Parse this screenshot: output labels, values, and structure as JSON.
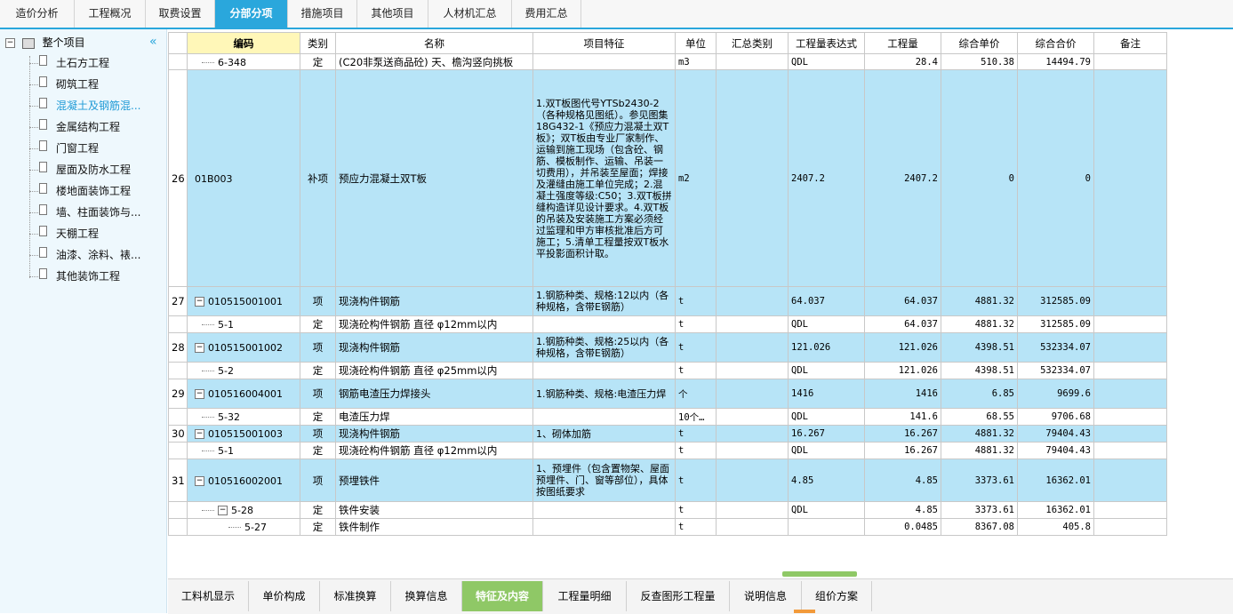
{
  "top_tabs": [
    "造价分析",
    "工程概况",
    "取费设置",
    "分部分项",
    "措施项目",
    "其他项目",
    "人材机汇总",
    "费用汇总"
  ],
  "active_top_tab": "分部分项",
  "tree": {
    "root": "整个项目",
    "items": [
      "土石方工程",
      "砌筑工程",
      "混凝土及钢筋混...",
      "金属结构工程",
      "门窗工程",
      "屋面及防水工程",
      "楼地面装饰工程",
      "墙、柱面装饰与...",
      "天棚工程",
      "油漆、涂料、裱...",
      "其他装饰工程"
    ],
    "selected": "混凝土及钢筋混..."
  },
  "columns": [
    "编码",
    "类别",
    "名称",
    "项目特征",
    "单位",
    "汇总类别",
    "工程量表达式",
    "工程量",
    "综合单价",
    "综合合价",
    "备注"
  ],
  "rows": [
    {
      "idx": "",
      "code": "6-348",
      "type": "定",
      "name": "(C20非泵送商品砼) 天、檐沟竖向挑板",
      "feature": "",
      "unit": "m3",
      "expr": "QDL",
      "qty": "28.4",
      "price": "510.38",
      "total": "14494.79",
      "blue": false,
      "level": 2,
      "box": false
    },
    {
      "idx": "26",
      "code": "01B003",
      "type": "补项",
      "name": "预应力混凝土双T板",
      "feature": "1.双T板图代号YTSb2430-2（各种规格见图纸）。参见图集18G432-1《预应力混凝土双T板》；双T板由专业厂家制作、运输到施工现场（包含砼、钢筋、模板制作、运输、吊装一切费用），并吊装至屋面；焊接及灌缝由施工单位完成；2.混凝土强度等级:C50；3.双T板拼缝构造详见设计要求。4.双T板的吊装及安装施工方案必须经过监理和甲方审核批准后方可施工；5.清单工程量按双T板水平投影面积计取。",
      "unit": "m2",
      "expr": "2407.2",
      "qty": "2407.2",
      "price": "0",
      "total": "0",
      "blue": true,
      "level": 1,
      "box": false
    },
    {
      "idx": "27",
      "code": "010515001001",
      "type": "项",
      "name": "现浇构件钢筋",
      "feature": "1.钢筋种类、规格:12以内（各种规格，含带E钢筋）",
      "unit": "t",
      "expr": "64.037",
      "qty": "64.037",
      "price": "4881.32",
      "total": "312585.09",
      "blue": true,
      "level": 1,
      "box": true
    },
    {
      "idx": "",
      "code": "5-1",
      "type": "定",
      "name": "现浇砼构件钢筋 直径 φ12mm以内",
      "feature": "",
      "unit": "t",
      "expr": "QDL",
      "qty": "64.037",
      "price": "4881.32",
      "total": "312585.09",
      "blue": false,
      "level": 2,
      "box": false
    },
    {
      "idx": "28",
      "code": "010515001002",
      "type": "项",
      "name": "现浇构件钢筋",
      "feature": "1.钢筋种类、规格:25以内（各种规格，含带E钢筋）",
      "unit": "t",
      "expr": "121.026",
      "qty": "121.026",
      "price": "4398.51",
      "total": "532334.07",
      "blue": true,
      "level": 1,
      "box": true
    },
    {
      "idx": "",
      "code": "5-2",
      "type": "定",
      "name": "现浇砼构件钢筋 直径 φ25mm以内",
      "feature": "",
      "unit": "t",
      "expr": "QDL",
      "qty": "121.026",
      "price": "4398.51",
      "total": "532334.07",
      "blue": false,
      "level": 2,
      "box": false
    },
    {
      "idx": "29",
      "code": "010516004001",
      "type": "项",
      "name": "钢筋电渣压力焊接头",
      "feature": "1.钢筋种类、规格:电渣压力焊",
      "unit": "个",
      "expr": "1416",
      "qty": "1416",
      "price": "6.85",
      "total": "9699.6",
      "blue": true,
      "level": 1,
      "box": true
    },
    {
      "idx": "",
      "code": "5-32",
      "type": "定",
      "name": "电渣压力焊",
      "feature": "",
      "unit": "10个…",
      "expr": "QDL",
      "qty": "141.6",
      "price": "68.55",
      "total": "9706.68",
      "blue": false,
      "level": 2,
      "box": false
    },
    {
      "idx": "30",
      "code": "010515001003",
      "type": "项",
      "name": "现浇构件钢筋",
      "feature": "1、砌体加筋",
      "unit": "t",
      "expr": "16.267",
      "qty": "16.267",
      "price": "4881.32",
      "total": "79404.43",
      "blue": true,
      "level": 1,
      "box": true
    },
    {
      "idx": "",
      "code": "5-1",
      "type": "定",
      "name": "现浇砼构件钢筋 直径 φ12mm以内",
      "feature": "",
      "unit": "t",
      "expr": "QDL",
      "qty": "16.267",
      "price": "4881.32",
      "total": "79404.43",
      "blue": false,
      "level": 2,
      "box": false
    },
    {
      "idx": "31",
      "code": "010516002001",
      "type": "项",
      "name": "预埋铁件",
      "feature": "1、预埋件（包含置物架、屋面预埋件、门、窗等部位），具体按图纸要求",
      "unit": "t",
      "expr": "4.85",
      "qty": "4.85",
      "price": "3373.61",
      "total": "16362.01",
      "blue": true,
      "level": 1,
      "box": true
    },
    {
      "idx": "",
      "code": "5-28",
      "type": "定",
      "name": "铁件安装",
      "feature": "",
      "unit": "t",
      "expr": "QDL",
      "qty": "4.85",
      "price": "3373.61",
      "total": "16362.01",
      "blue": false,
      "level": 2,
      "box": true
    },
    {
      "idx": "",
      "code": "5-27",
      "type": "定",
      "name": "铁件制作",
      "feature": "",
      "unit": "t",
      "expr": "",
      "qty": "0.0485",
      "price": "8367.08",
      "total": "405.8",
      "blue": false,
      "level": 3,
      "box": false
    }
  ],
  "bottom_tabs": [
    "工料机显示",
    "单价构成",
    "标准换算",
    "换算信息",
    "特征及内容",
    "工程量明细",
    "反查图形工程量",
    "说明信息",
    "组价方案"
  ],
  "active_bottom_tab": "特征及内容",
  "colors": {
    "accent": "#2aa7dc",
    "row_blue": "#b7e4f7",
    "header_code": "#fff7b8",
    "bottom_active": "#8fc866"
  }
}
